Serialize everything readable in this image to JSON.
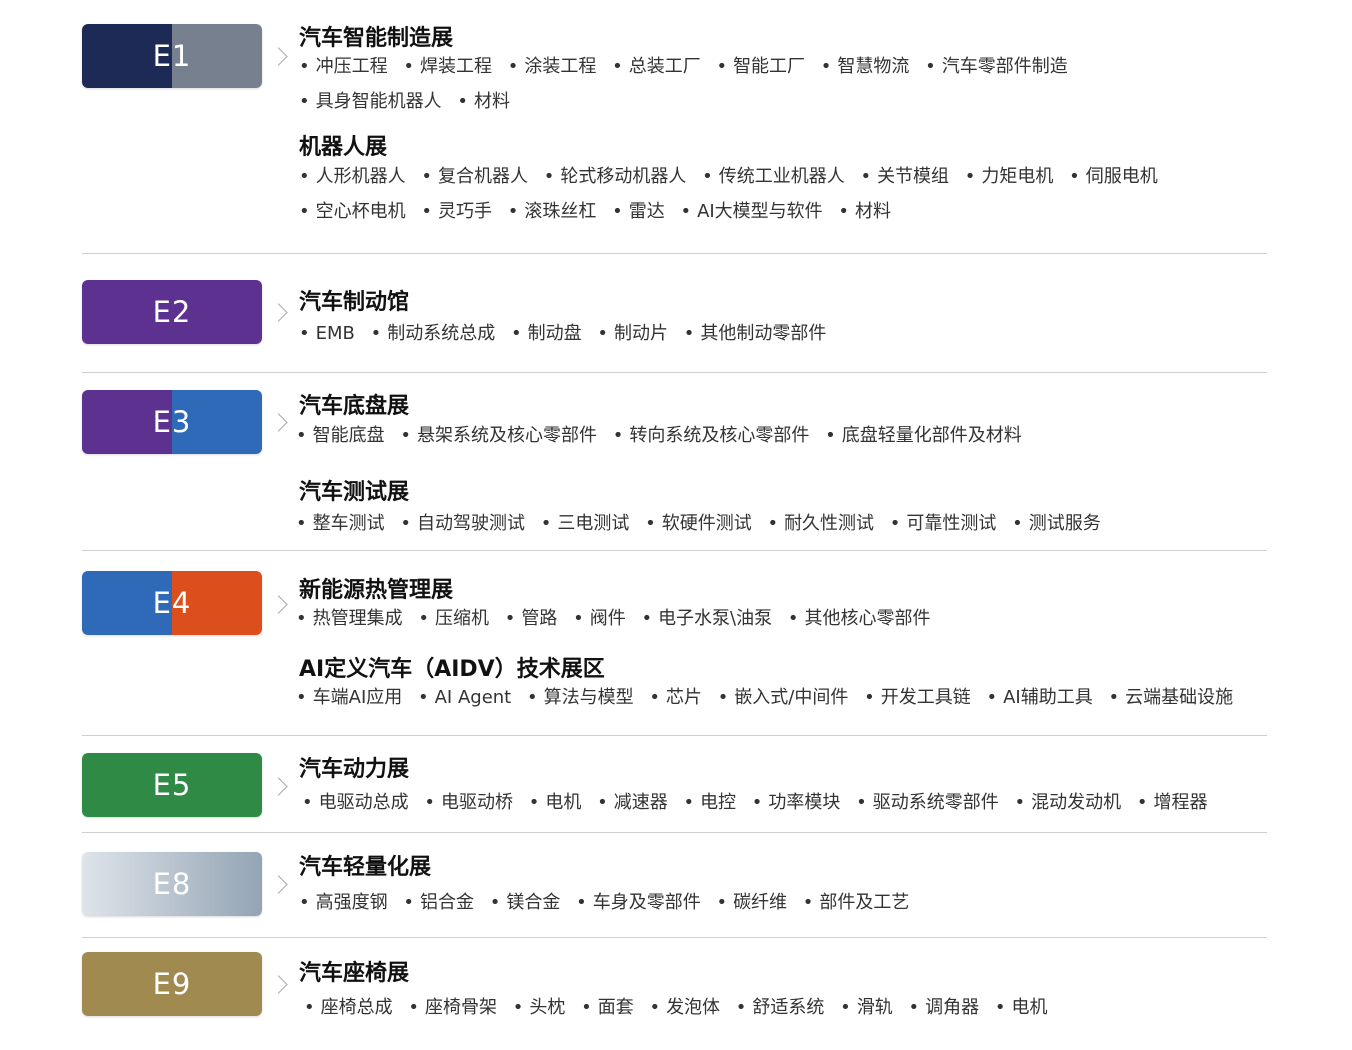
{
  "halls": [
    {
      "code": "E1",
      "colors": [
        "#1d2a55",
        "#76808f"
      ],
      "sections": [
        {
          "title": "汽车智能制造展",
          "lines": [
            [
              "冲压工程",
              "焊装工程",
              "涂装工程",
              "总装工厂",
              "智能工厂",
              "智慧物流",
              "汽车零部件制造"
            ],
            [
              "具身智能机器人",
              "材料"
            ]
          ]
        },
        {
          "title": "机器人展",
          "lines": [
            [
              "人形机器人",
              "复合机器人",
              "轮式移动机器人",
              "传统工业机器人",
              "关节模组",
              "力矩电机",
              "伺服电机"
            ],
            [
              "空心杯电机",
              "灵巧手",
              "滚珠丝杠",
              "雷达",
              "AI大模型与软件",
              "材料"
            ]
          ]
        }
      ]
    },
    {
      "code": "E2",
      "colors": [
        "#5c3190",
        "#5c3190"
      ],
      "sections": [
        {
          "title": "汽车制动馆",
          "lines": [
            [
              "EMB",
              "制动系统总成",
              "制动盘",
              "制动片",
              "其他制动零部件"
            ]
          ]
        }
      ]
    },
    {
      "code": "E3",
      "colors": [
        "#5c3190",
        "#2e6ab7"
      ],
      "sections": [
        {
          "title": "汽车底盘展",
          "lines": [
            [
              "智能底盘",
              "悬架系统及核心零部件",
              "转向系统及核心零部件",
              "底盘轻量化部件及材料"
            ]
          ]
        },
        {
          "title": "汽车测试展",
          "lines": [
            [
              "整车测试",
              "自动驾驶测试",
              "三电测试",
              "软硬件测试",
              "耐久性测试",
              "可靠性测试",
              "测试服务"
            ]
          ]
        }
      ]
    },
    {
      "code": "E4",
      "colors": [
        "#2e6ab7",
        "#dc4f1c"
      ],
      "sections": [
        {
          "title": "新能源热管理展",
          "lines": [
            [
              "热管理集成",
              "压缩机",
              "管路",
              "阀件",
              "电子水泵\\油泵",
              "其他核心零部件"
            ]
          ]
        },
        {
          "title": "AI定义汽车（AIDV）技术展区",
          "lines": [
            [
              "车端AI应用",
              "AI Agent",
              "算法与模型",
              "芯片",
              "嵌入式/中间件",
              "开发工具链",
              "AI辅助工具",
              "云端基础设施"
            ]
          ]
        }
      ]
    },
    {
      "code": "E5",
      "colors": [
        "#2e8a45",
        "#2e8a45"
      ],
      "sections": [
        {
          "title": "汽车动力展",
          "lines": [
            [
              "电驱动总成",
              "电驱动桥",
              "电机",
              "减速器",
              "电控",
              "功率模块",
              "驱动系统零部件",
              "混动发动机",
              "增程器"
            ]
          ]
        }
      ]
    },
    {
      "code": "E8",
      "colors": [
        "#dfe4ea",
        "#93a4b4"
      ],
      "sections": [
        {
          "title": "汽车轻量化展",
          "lines": [
            [
              "高强度钢",
              "铝合金",
              "镁合金",
              "车身及零部件",
              "碳纤维",
              "部件及工艺"
            ]
          ]
        }
      ]
    },
    {
      "code": "E9",
      "colors": [
        "#a08a4f",
        "#a08a4f"
      ],
      "sections": [
        {
          "title": "汽车座椅展",
          "lines": [
            [
              "座椅总成",
              "座椅骨架",
              "头枕",
              "面套",
              "发泡体",
              "舒适系统",
              "滑轨",
              "调角器",
              "电机"
            ]
          ]
        }
      ]
    }
  ]
}
